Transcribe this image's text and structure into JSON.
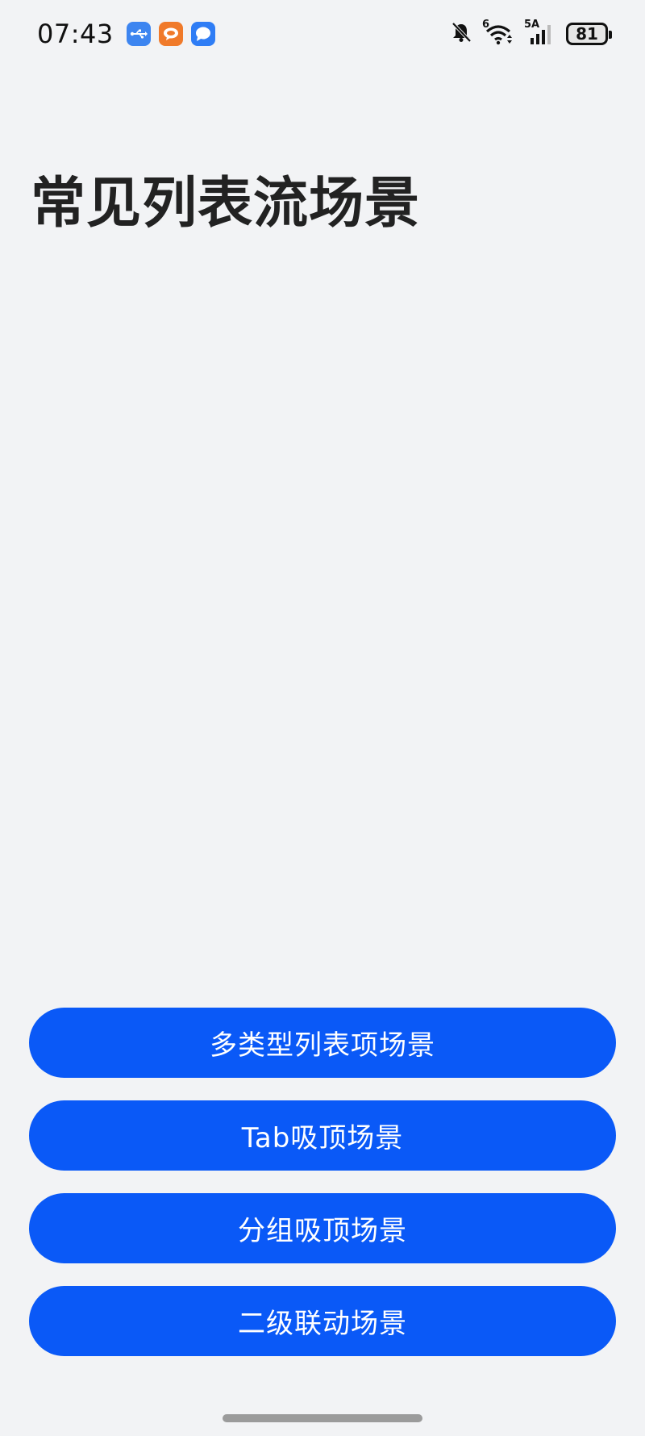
{
  "status_bar": {
    "time": "07:43",
    "app_icons": [
      "usb-icon",
      "cloud-chat-icon",
      "message-icon"
    ],
    "icons": [
      "mute-bell-icon",
      "wifi-icon",
      "cellular-signal-icon",
      "battery-icon"
    ],
    "wifi_label": "6",
    "network_label": "5A",
    "battery_level": "81"
  },
  "page": {
    "title": "常见列表流场景"
  },
  "buttons": [
    {
      "label": "多类型列表项场景"
    },
    {
      "label": "Tab吸顶场景"
    },
    {
      "label": "分组吸顶场景"
    },
    {
      "label": "二级联动场景"
    }
  ],
  "colors": {
    "background": "#f2f3f5",
    "button": "#0a59f7",
    "button_text": "#ffffff",
    "title": "#222222"
  }
}
